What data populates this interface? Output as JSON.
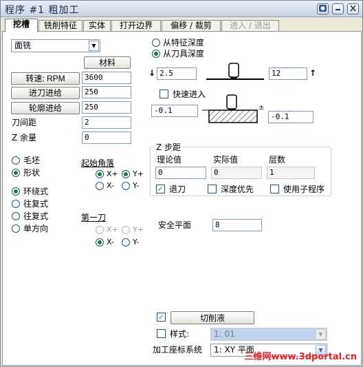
{
  "window": {
    "title": "程序 #1 粗加工",
    "buttons": [
      "help-icon",
      "minimize-icon",
      "close-icon"
    ]
  },
  "tabs": [
    {
      "label": "挖槽",
      "active": true
    },
    {
      "label": "铣削特征"
    },
    {
      "label": "实体"
    },
    {
      "label": "打开边界"
    },
    {
      "label": "偏移 / 裁剪"
    },
    {
      "label": "进入 / 退出",
      "disabled": true
    }
  ],
  "left": {
    "operation_type": "面铣",
    "material_button": "材料",
    "speed_button": "转速: RPM",
    "speed_value": "3600",
    "feed_button": "进刀进给",
    "feed_value": "250",
    "contour_feed_button": "轮廓进给",
    "contour_feed_value": "250",
    "tool_spacing_label": "刀间距",
    "tool_spacing_value": "2",
    "z_allowance_label": "Z 余量",
    "z_allowance_value": "0",
    "stock_options": [
      {
        "label": "毛坯",
        "selected": false
      },
      {
        "label": "形状",
        "selected": true
      }
    ],
    "path_options": [
      {
        "label": "环绕式",
        "selected": true
      },
      {
        "label": "往复式",
        "selected": false
      },
      {
        "label": "往复式",
        "selected": false
      },
      {
        "label": "单方向",
        "selected": false
      }
    ],
    "start_corner": {
      "title": "起始角落",
      "options": [
        {
          "label": "X+",
          "selected": true
        },
        {
          "label": "Y+",
          "selected": true
        },
        {
          "label": "X-",
          "selected": false
        },
        {
          "label": "Y-",
          "selected": false
        }
      ]
    },
    "first_cut": {
      "title": "第一刀",
      "options": [
        {
          "label": "X+",
          "selected": false,
          "disabled": true
        },
        {
          "label": "Y+",
          "selected": false,
          "disabled": true
        },
        {
          "label": "X-",
          "selected": true
        },
        {
          "label": "Y-",
          "selected": false
        }
      ]
    }
  },
  "right": {
    "depth_options": [
      {
        "label": "从特征深度",
        "selected": false
      },
      {
        "label": "从刀具深度",
        "selected": true
      }
    ],
    "depth_down_value": "2.5",
    "depth_up_value": "12",
    "fast_entry_label": "快速进入",
    "fast_entry_checked": false,
    "left_offset_value": "-0.1",
    "right_offset_value": "-0.1",
    "z_step": {
      "title": "Z 步距",
      "headers": [
        "理论值",
        "实际值",
        "层数"
      ],
      "values": [
        "0",
        "0",
        "1"
      ],
      "retract_label": "退刀",
      "retract_checked": true,
      "depth_first_label": "深度优先",
      "depth_first_checked": false,
      "subprogram_label": "使用子程序",
      "subprogram_checked": false
    },
    "safe_plane_label": "安全平面",
    "safe_plane_value": "8"
  },
  "bottom": {
    "coolant_checked": true,
    "coolant_button": "切削液",
    "style_label": "样式:",
    "style_checked": false,
    "style_value": "1: 01",
    "coord_label": "加工座标系统",
    "coord_value": "1: XY 平面"
  },
  "watermark": "三维网www.3dportal.cn",
  "colors": {
    "accent_radio": "#217a2e",
    "check": "#21a121",
    "watermark": "#e32323"
  }
}
